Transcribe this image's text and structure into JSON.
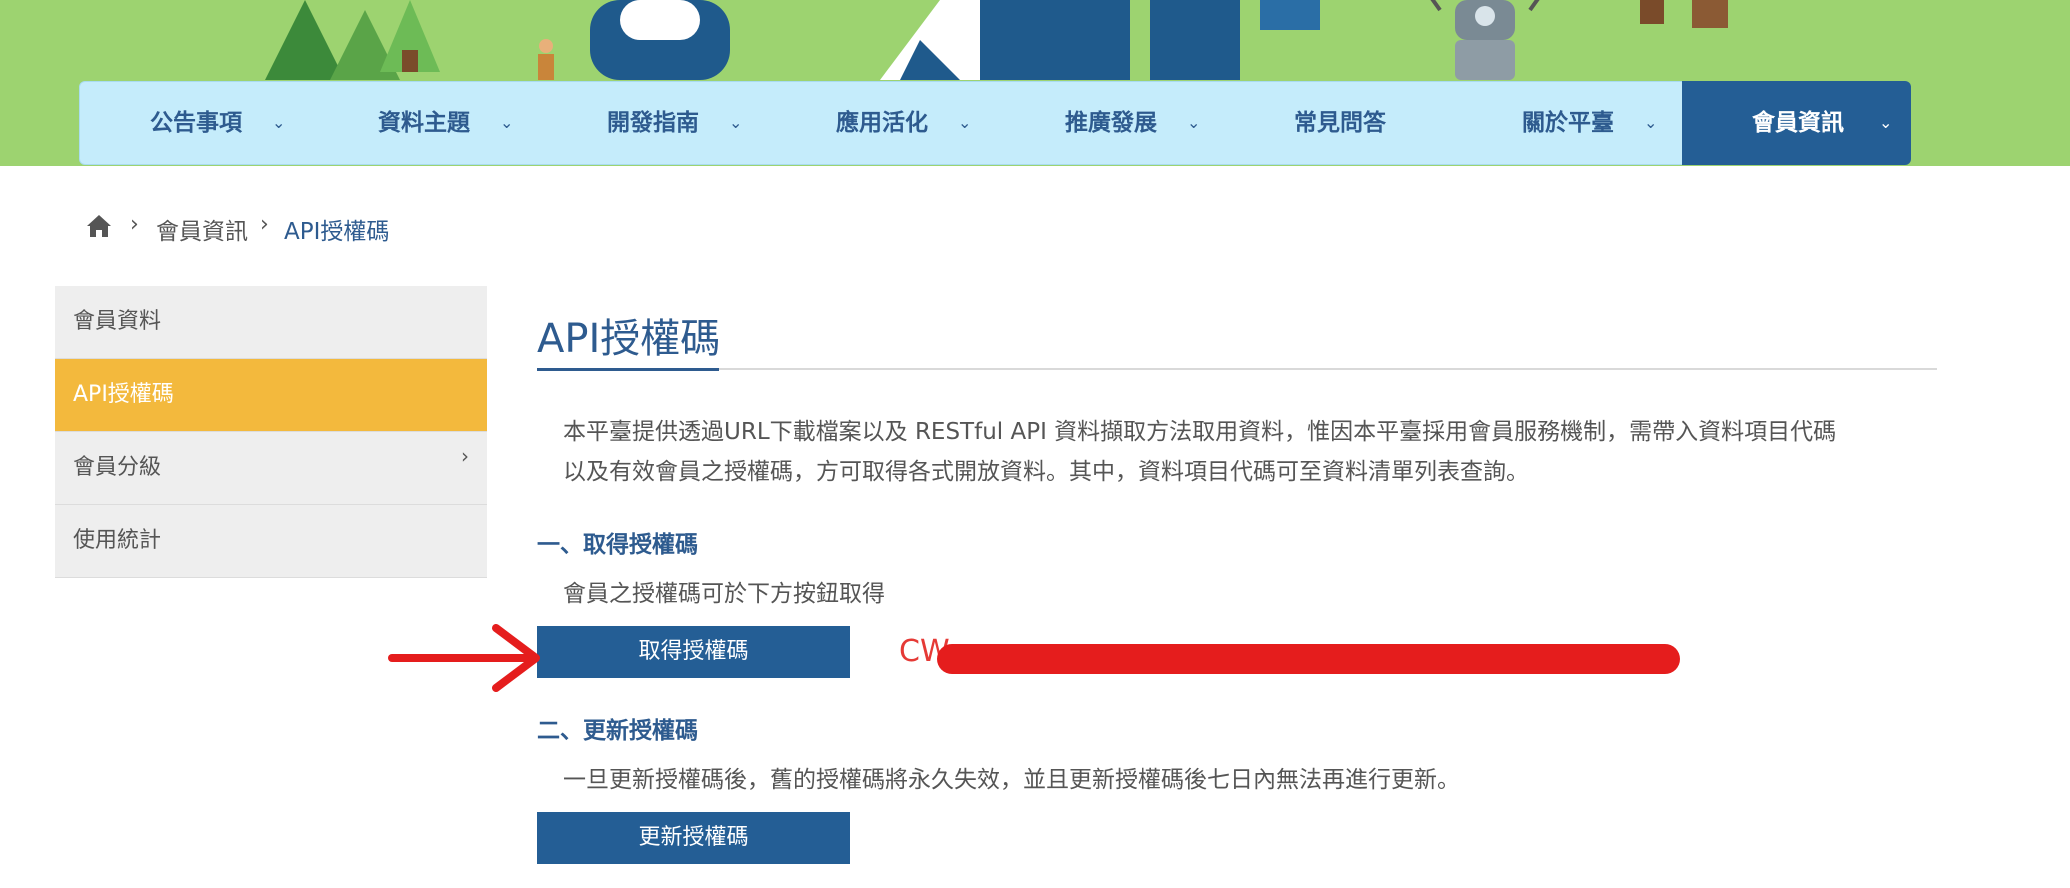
{
  "nav": {
    "items": [
      {
        "label": "公告事項",
        "has_dropdown": true
      },
      {
        "label": "資料主題",
        "has_dropdown": true
      },
      {
        "label": "開發指南",
        "has_dropdown": true
      },
      {
        "label": "應用活化",
        "has_dropdown": true
      },
      {
        "label": "推廣發展",
        "has_dropdown": true
      },
      {
        "label": "常見問答",
        "has_dropdown": false
      },
      {
        "label": "關於平臺",
        "has_dropdown": true
      }
    ],
    "active_item": {
      "label": "會員資訊",
      "has_dropdown": true
    },
    "chevron_glyph": "⌄"
  },
  "breadcrumb": {
    "home_icon": "home-icon",
    "separator": "›",
    "items": [
      "會員資訊"
    ],
    "current": "API授權碼"
  },
  "sidebar": {
    "items": [
      {
        "label": "會員資料",
        "active": false,
        "has_submenu": false
      },
      {
        "label": "API授權碼",
        "active": true,
        "has_submenu": false
      },
      {
        "label": "會員分級",
        "active": false,
        "has_submenu": true
      },
      {
        "label": "使用統計",
        "active": false,
        "has_submenu": false
      }
    ],
    "submenu_glyph": "›"
  },
  "main": {
    "title": "API授權碼",
    "intro_line1": "本平臺提供透過URL下載檔案以及 RESTful API 資料擷取方法取用資料，惟因本平臺採用會員服務機制，需帶入資料項目代碼",
    "intro_line2": "以及有效會員之授權碼，方可取得各式開放資料。其中，資料項目代碼可至資料清單列表查詢。",
    "section1": {
      "heading": "一、取得授權碼",
      "desc": "會員之授權碼可於下方按鈕取得",
      "button_label": "取得授權碼",
      "token_prefix": "CW"
    },
    "section2": {
      "heading": "二、更新授權碼",
      "desc": "一旦更新授權碼後，舊的授權碼將永久失效，並且更新授權碼後七日內無法再進行更新。",
      "button_label": "更新授權碼"
    }
  },
  "colors": {
    "nav_bg": "#c5ecfb",
    "nav_text": "#2e5b8f",
    "active_nav_bg": "#245e95",
    "sidebar_active": "#f3b93d",
    "button_bg": "#245e95",
    "annotation_red": "#e51d1d",
    "banner_green": "#9dd370"
  }
}
